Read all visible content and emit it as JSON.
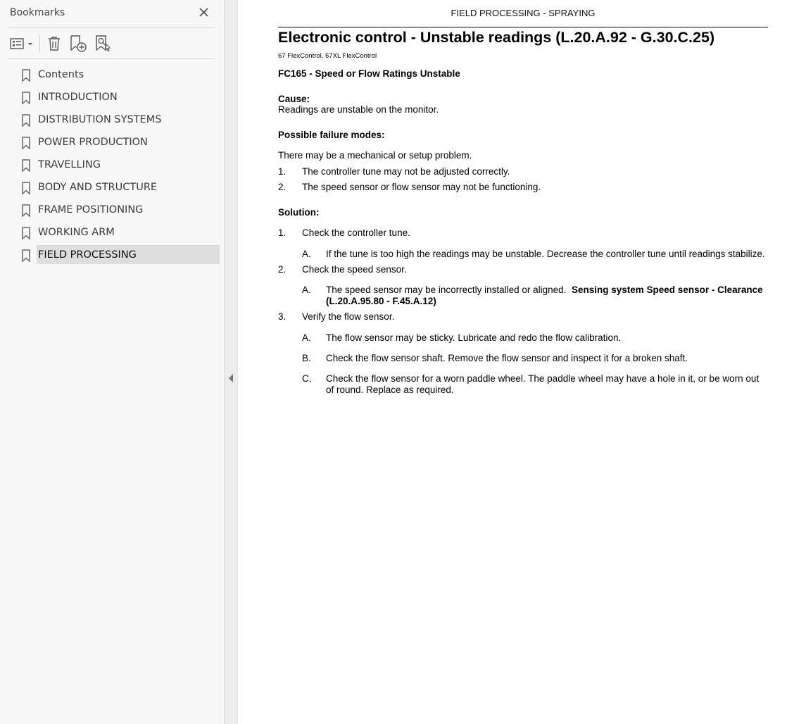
{
  "bookmarks_panel": {
    "title": "Bookmarks",
    "icons": {
      "close": "close-icon",
      "options": "list-options-icon",
      "delete": "trash-icon",
      "new_bookmark": "new-bookmark-icon",
      "find_bookmark": "find-bookmark-icon"
    },
    "items": [
      {
        "label": "Contents"
      },
      {
        "label": "INTRODUCTION"
      },
      {
        "label": "DISTRIBUTION SYSTEMS"
      },
      {
        "label": "POWER PRODUCTION"
      },
      {
        "label": "TRAVELLING"
      },
      {
        "label": "BODY AND STRUCTURE"
      },
      {
        "label": "FRAME POSITIONING"
      },
      {
        "label": "WORKING ARM"
      },
      {
        "label": "FIELD PROCESSING",
        "selected": true
      }
    ]
  },
  "document": {
    "running_header": "FIELD PROCESSING - SPRAYING",
    "title": "Electronic control - Unstable readings (L.20.A.92 - G.30.C.25)",
    "applicability": "67 FlexControl, 67XL FlexControl",
    "fault_code": "FC165 - Speed or Flow Ratings Unstable",
    "cause_heading": "Cause:",
    "cause_text": "Readings are unstable on the monitor.",
    "failure_heading": "Possible failure modes:",
    "failure_intro": "There may be a mechanical or setup problem.",
    "failure_modes": [
      {
        "num": "1.",
        "text": "The controller tune may not be adjusted correctly."
      },
      {
        "num": "2.",
        "text": "The speed sensor or flow sensor may not be functioning."
      }
    ],
    "solution_heading": "Solution:",
    "solutions": [
      {
        "num": "1.",
        "text": "Check the controller tune.",
        "subs": [
          {
            "letter": "A.",
            "text": "If the tune is too high the readings may be unstable. Decrease the controller tune until readings stabilize."
          }
        ]
      },
      {
        "num": "2.",
        "text": "Check the speed sensor.",
        "subs": [
          {
            "letter": "A.",
            "text": "The speed sensor may be incorrectly installed or aligned.",
            "link_line1": "Sensing system Speed sensor - Clearance",
            "link_line2": "(L.20.A.95.80 - F.45.A.12)"
          }
        ]
      },
      {
        "num": "3.",
        "text": "Verify the flow sensor.",
        "subs": [
          {
            "letter": "A.",
            "text": "The flow sensor may be sticky. Lubricate and redo the flow calibration."
          },
          {
            "letter": "B.",
            "text": "Check the flow sensor shaft. Remove the flow sensor and inspect it for a broken shaft."
          },
          {
            "letter": "C.",
            "text_line1": "Check the flow sensor for a worn paddle wheel. The paddle wheel may have a hole in it, or be worn out",
            "text_line2": "of round.  Replace as required."
          }
        ]
      }
    ]
  }
}
